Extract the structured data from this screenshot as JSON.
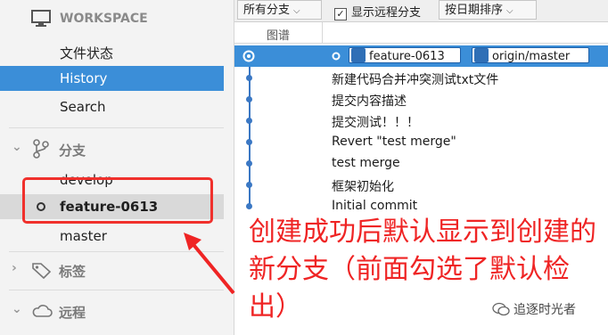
{
  "sidebar": {
    "workspace_header": "WORKSPACE",
    "workspace_items": [
      {
        "label": "文件状态"
      },
      {
        "label": "History"
      },
      {
        "label": "Search"
      }
    ],
    "branches_header": "分支",
    "branches": [
      {
        "label": "develop"
      },
      {
        "label": "feature-0613"
      },
      {
        "label": "master"
      }
    ],
    "tags_header": "标签",
    "remote_header": "远程"
  },
  "toolbar": {
    "branch_filter": "所有分支",
    "show_remote_label": "显示远程分支",
    "show_remote_checked": true,
    "sort_label": "按日期排序"
  },
  "columns": {
    "graph": "图谱"
  },
  "commits": [
    {
      "message": "",
      "tags": [
        "feature-0613",
        "origin/master"
      ]
    },
    {
      "message": "新建代码合并冲突测试txt文件"
    },
    {
      "message": "提交内容描述"
    },
    {
      "message": "提交测试！！！"
    },
    {
      "message": "Revert \"test merge\""
    },
    {
      "message": "test merge"
    },
    {
      "message": "框架初始化"
    },
    {
      "message": "Initial commit"
    }
  ],
  "annotation": {
    "text": "创建成功后默认显示到创建的新分支（前面勾选了默认检出）"
  },
  "watermark": "追逐时光者",
  "colors": {
    "accent": "#3b8ed8",
    "annotation_red": "#ef2424",
    "graph_line": "#3b78c4"
  }
}
